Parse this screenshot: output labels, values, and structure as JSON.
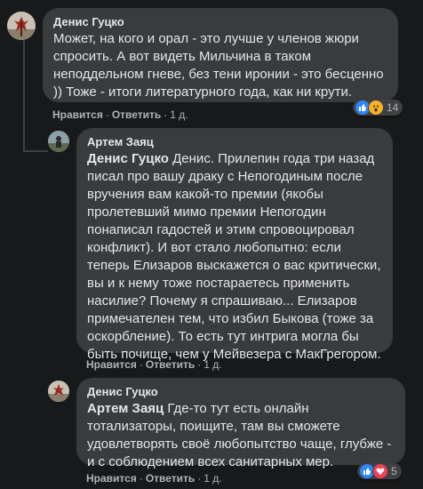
{
  "comments": [
    {
      "author": "Денис Гуцко",
      "text": "Может, на кого и орал - это лучше у членов жюри спросить. А вот видеть Мильчина в таком неподдельном гневе, без тени иронии - это бесценно )) Тоже - итоги литературного года, как ни крути.",
      "like_label": "Нравится",
      "reply_label": "Ответить",
      "time": "1 д.",
      "reactions_count": "14",
      "reactions": [
        "like-icon",
        "wow-icon"
      ]
    },
    {
      "author": "Артем Заяц",
      "mention": "Денис Гуцко",
      "text": " Денис. Прилепин года три назад писал про вашу драку с Непогодиным после вручения вам какой-то премии (якобы пролетевший мимо премии Непогодин понаписал гадостей и этим спровоцировал конфликт). И вот стало любопытно: если теперь Елизаров выскажется о вас критически, вы и к нему тоже постараетесь применить насилие? Почему я спрашиваю... Елизаров примечателен тем, что избил Быкова (тоже за оскорбление). То есть тут интрига могла бы быть почище, чем у Мейвезера с МакГрегором.",
      "like_label": "Нравится",
      "reply_label": "Ответить",
      "time": "1 д."
    },
    {
      "author": "Денис Гуцко",
      "mention": "Артем Заяц",
      "text": " Где-то тут есть онлайн тотализаторы, поищите, там вы сможете удовлетворять своё любопытство чаще, глубже - и с соблюдением всех санитарных мер.",
      "like_label": "Нравится",
      "reply_label": "Ответить",
      "time": "1 д.",
      "reactions_count": "5",
      "reactions": [
        "like-icon",
        "love-icon"
      ]
    }
  ],
  "colors": {
    "background": "#18191a",
    "bubble": "#3a3b3c",
    "text": "#e4e6eb",
    "secondary": "#b0b3b8",
    "like": "#2d88ff",
    "love": "#f33e58",
    "wow": "#f7b125"
  }
}
